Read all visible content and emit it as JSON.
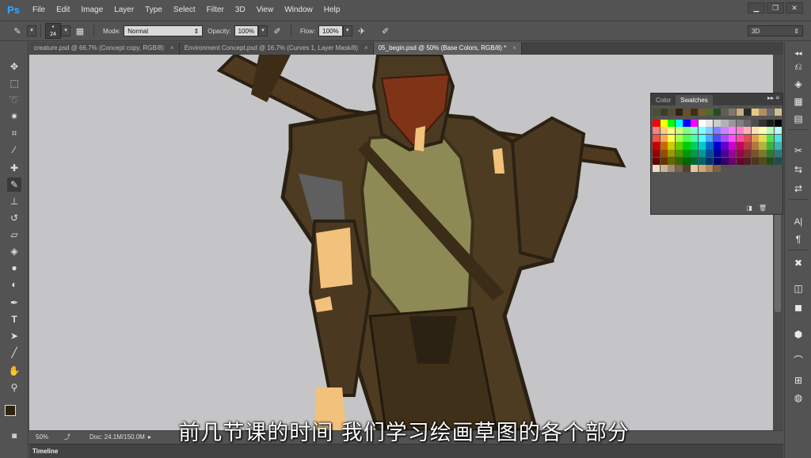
{
  "app": {
    "logo": "Ps",
    "menu": [
      "File",
      "Edit",
      "Image",
      "Layer",
      "Type",
      "Select",
      "Filter",
      "3D",
      "View",
      "Window",
      "Help"
    ],
    "window_controls": {
      "minimize": "▁",
      "restore": "❐",
      "close": "✕"
    }
  },
  "options": {
    "brush_size": "24",
    "mode_label": "Mode:",
    "mode_value": "Normal",
    "opacity_label": "Opacity:",
    "opacity_value": "100%",
    "flow_label": "Flow:",
    "flow_value": "100%",
    "workspace": "3D"
  },
  "tabs": [
    {
      "label": "creature.psd @ 66.7% (Concept copy, RGB/8)",
      "close": "×"
    },
    {
      "label": "Environment Concept.psd @ 16.7% (Curves 1, Layer Mask/8)",
      "close": "×"
    },
    {
      "label": "05_begin.psd @ 50% (Base Colors, RGB/8) *",
      "close": "×"
    }
  ],
  "swatches_panel": {
    "tab_color": "Color",
    "tab_swatches": "Swatches",
    "collapse": "▸▸",
    "menu": "≡"
  },
  "status": {
    "zoom": "50%",
    "doc_info": "Doc: 24.1M/150.0M"
  },
  "timeline": {
    "label": "Timeline"
  },
  "subtitle": "前几节课的时间 我们学习绘画草图的各个部分",
  "colors": {
    "ui_bg": "#535353",
    "canvas_bg": "#c5c5c7",
    "ps_blue": "#31a8ff"
  },
  "icons": {
    "tools": [
      "move-icon",
      "marquee-icon",
      "lasso-icon",
      "magic-wand-icon",
      "crop-icon",
      "eyedropper-icon",
      "healing-brush-icon",
      "brush-icon",
      "clone-stamp-icon",
      "history-brush-icon",
      "eraser-icon",
      "paint-bucket-icon",
      "blur-icon",
      "dodge-icon",
      "pen-icon",
      "type-icon",
      "path-selection-icon",
      "line-icon",
      "hand-icon",
      "zoom-icon"
    ],
    "dock": [
      "history-icon",
      "layers-icon",
      "swatches-icon",
      "brush-presets-icon",
      "adjustments-icon",
      "character-icon",
      "paragraph-icon",
      "tools-icon",
      "info-icon",
      "properties-icon",
      "3d-icon",
      "paths-icon",
      "channels-icon"
    ]
  }
}
